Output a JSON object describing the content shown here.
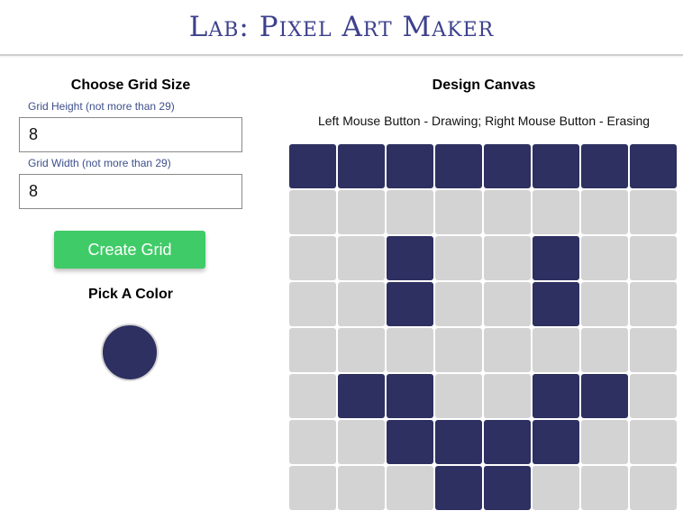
{
  "header": {
    "title": "Lab: Pixel Art Maker"
  },
  "controls": {
    "grid_size_title": "Choose Grid Size",
    "height_label": "Grid Height (not more than 29)",
    "height_value": "8",
    "width_label": "Grid Width (not more than 29)",
    "width_value": "8",
    "create_button_label": "Create Grid",
    "pick_color_title": "Pick A Color",
    "selected_color": "#2d3060"
  },
  "canvas": {
    "title": "Design Canvas",
    "instructions": "Left Mouse Button - Drawing; Right Mouse Button - Erasing",
    "rows": 8,
    "cols": 8,
    "empty_color": "#d3d3d3",
    "filled_color": "#2d3060",
    "cells": [
      [
        1,
        1,
        1,
        1,
        1,
        1,
        1,
        1
      ],
      [
        0,
        0,
        0,
        0,
        0,
        0,
        0,
        0
      ],
      [
        0,
        0,
        1,
        0,
        0,
        1,
        0,
        0
      ],
      [
        0,
        0,
        1,
        0,
        0,
        1,
        0,
        0
      ],
      [
        0,
        0,
        0,
        0,
        0,
        0,
        0,
        0
      ],
      [
        0,
        1,
        1,
        0,
        0,
        1,
        1,
        0
      ],
      [
        0,
        0,
        1,
        1,
        1,
        1,
        0,
        0
      ],
      [
        0,
        0,
        0,
        1,
        1,
        0,
        0,
        0
      ]
    ]
  }
}
